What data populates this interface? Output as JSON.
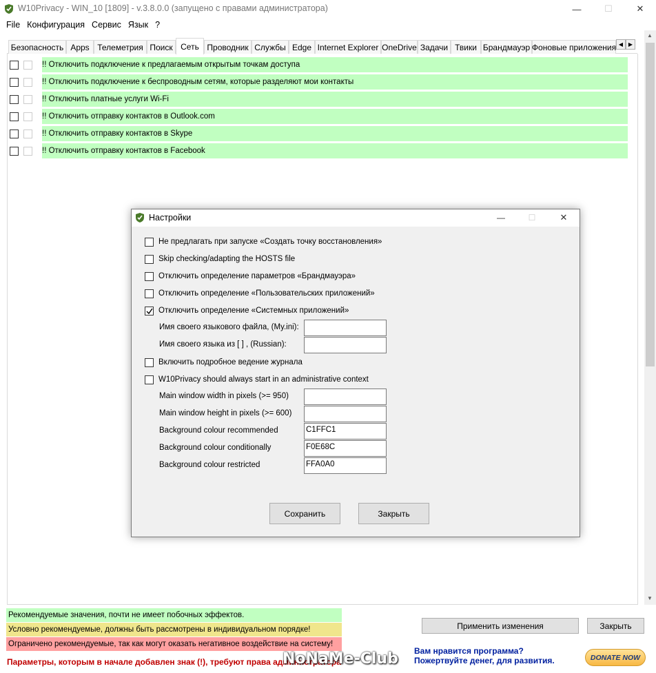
{
  "window": {
    "title": "W10Privacy - WIN_10 [1809]  - v.3.8.0.0 (запущено с правами администратора)",
    "minimize": "—",
    "maximize": "☐",
    "close": "✕"
  },
  "menu": [
    "File",
    "Конфигурация",
    "Сервис",
    "Язык",
    "?"
  ],
  "tabs": [
    "Безопасность",
    "Apps",
    "Телеметрия",
    "Поиск",
    "Сеть",
    "Проводник",
    "Службы",
    "Edge",
    "Internet Explorer",
    "OneDrive",
    "Задачи",
    "Твики",
    "Брандмауэр",
    "Фоновые приложения"
  ],
  "active_tab": "Сеть",
  "options": [
    "!! Отключить подключение к предлагаемым открытым точкам доступа",
    "!! Отключить подключение к беспроводным сетям, которые разделяют мои контакты",
    "!! Отключить платные услуги Wi-Fi",
    "!! Отключить отправку контактов в Outlook.com",
    "!! Отключить отправку контактов в Skype",
    "!! Отключить отправку контактов в Facebook"
  ],
  "dialog": {
    "title": "Настройки",
    "checkboxes": [
      {
        "label": "Не предлагать при запуске «Создать точку восстановления»",
        "checked": false
      },
      {
        "label": "Skip checking/adapting the HOSTS file",
        "checked": false
      },
      {
        "label": "Отключить определение параметров «Брандмауэра»",
        "checked": false
      },
      {
        "label": "Отключить определение «Пользовательских приложений»",
        "checked": false
      },
      {
        "label": "Отключить определение «Системных приложений»",
        "checked": true
      }
    ],
    "lang_file_label": "Имя своего языкового файла, (My.ini):",
    "lang_file_value": "",
    "lang_name_label": "Имя своего языка из [ ] , (Russian):",
    "lang_name_value": "",
    "log_label": "Включить подробное ведение журнала",
    "admin_label": "W10Privacy should always start in an administrative context",
    "fields": [
      {
        "label": "Main window width in pixels (>= 950)",
        "value": ""
      },
      {
        "label": "Main window height in pixels (>= 600)",
        "value": ""
      },
      {
        "label": "Background colour recommended",
        "value": "C1FFC1"
      },
      {
        "label": "Background colour conditionally",
        "value": "F0E68C"
      },
      {
        "label": "Background colour restricted",
        "value": "FFA0A0"
      }
    ],
    "save": "Сохранить",
    "close": "Закрыть"
  },
  "legend": {
    "recommended": "Рекомендуемые значения, почти не имеет побочных эффектов.",
    "conditional": "Условно рекомендуемые, должны быть рассмотрены в индивидуальном порядке!",
    "restricted": "Ограничено рекомендуемые, так как могут оказать негативное воздействие на систему!",
    "warning": "Параметры, которым в начале добавлен знак (!), требуют права администратора"
  },
  "colors": {
    "recommended": "#C1FFC1",
    "conditional": "#F0E68C",
    "restricted": "#FFA0A0"
  },
  "buttons": {
    "apply": "Применить изменения",
    "close": "Закрыть"
  },
  "donate": {
    "line1": "Вам нравится программа?",
    "line2": "Пожертвуйте денег, для развития.",
    "button": "DONATE NOW"
  },
  "watermark": "NoNaMe-Club"
}
